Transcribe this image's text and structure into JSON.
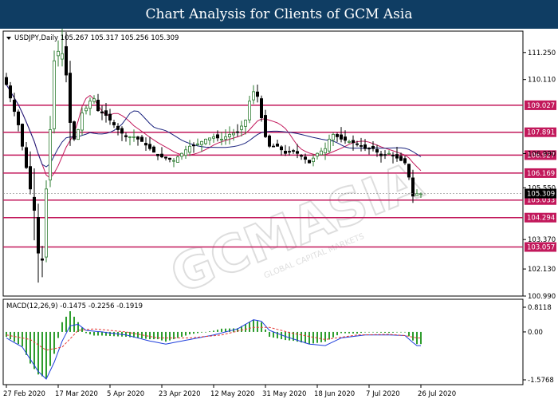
{
  "header": {
    "title": "Chart Analysis for Clients of GCM Asia"
  },
  "price_panel": {
    "label": "USDJPY,Daily  105.267 105.317 105.256 105.309",
    "current_price": "105.309"
  },
  "macd_panel": {
    "label": "MACD(12,26,9) -0.1475 -0.2256 -0.1919"
  },
  "watermark": {
    "text": "GCMASIA",
    "sub": "GLOBAL CAPITAL MARKETS"
  },
  "colors": {
    "up": "#2e7d32",
    "down": "#000000",
    "ma_fast": "#c2185b",
    "ma_slow": "#1a237e",
    "level": "#c2185b",
    "level_label_bg": "#c2185b",
    "price_label_bg": "#000000",
    "macd_hist": "#2e9d2e",
    "macd_line": "#1f3fdc",
    "macd_signal": "#e53935"
  },
  "chart_data": {
    "type": "candlestick",
    "symbol": "USDJPY",
    "timeframe": "Daily",
    "ylim": [
      100.99,
      112.15
    ],
    "y_ticks": [
      "111.250",
      "110.110",
      "109.027",
      "107.891",
      "106.990",
      "106.927",
      "106.169",
      "105.550",
      "105.309",
      "105.033",
      "104.294",
      "103.370",
      "103.057",
      "102.130",
      "100.990"
    ],
    "levels": [
      "109.027",
      "107.891",
      "106.927",
      "106.169",
      "105.033",
      "104.294",
      "103.057"
    ],
    "x_ticks": [
      "27 Feb 2020",
      "17 Mar 2020",
      "5 Apr 2020",
      "23 Apr 2020",
      "12 May 2020",
      "31 May 2020",
      "18 Jun 2020",
      "7 Jul 2020",
      "26 Jul 2020"
    ],
    "x_tick_index": [
      0,
      13,
      26,
      39,
      52,
      65,
      78,
      91,
      104
    ],
    "close_anchors": [
      [
        0,
        109.9
      ],
      [
        3,
        108.2
      ],
      [
        5,
        106.4
      ],
      [
        7,
        104.6
      ],
      [
        8,
        102.8
      ],
      [
        9,
        102.5
      ],
      [
        10,
        105.5
      ],
      [
        11,
        108.0
      ],
      [
        12,
        110.9
      ],
      [
        13,
        111.3
      ],
      [
        14,
        111.2
      ],
      [
        15,
        110.3
      ],
      [
        16,
        108.3
      ],
      [
        17,
        107.6
      ],
      [
        18,
        108.0
      ],
      [
        19,
        108.7
      ],
      [
        20,
        108.9
      ],
      [
        21,
        109.2
      ],
      [
        22,
        109.3
      ],
      [
        23,
        108.8
      ],
      [
        24,
        108.7
      ],
      [
        25,
        108.6
      ],
      [
        26,
        108.4
      ],
      [
        28,
        108.0
      ],
      [
        30,
        107.7
      ],
      [
        32,
        107.7
      ],
      [
        34,
        107.5
      ],
      [
        36,
        107.2
      ],
      [
        38,
        106.9
      ],
      [
        40,
        106.8
      ],
      [
        42,
        106.7
      ],
      [
        44,
        107.0
      ],
      [
        46,
        107.3
      ],
      [
        48,
        107.4
      ],
      [
        50,
        107.6
      ],
      [
        52,
        107.7
      ],
      [
        54,
        107.6
      ],
      [
        56,
        107.8
      ],
      [
        58,
        107.9
      ],
      [
        60,
        108.4
      ],
      [
        61,
        109.2
      ],
      [
        62,
        109.6
      ],
      [
        63,
        109.4
      ],
      [
        64,
        108.5
      ],
      [
        65,
        107.7
      ],
      [
        66,
        107.3
      ],
      [
        68,
        107.3
      ],
      [
        70,
        107.0
      ],
      [
        72,
        107.1
      ],
      [
        74,
        106.9
      ],
      [
        76,
        106.6
      ],
      [
        78,
        107.0
      ],
      [
        80,
        107.2
      ],
      [
        81,
        107.6
      ],
      [
        82,
        107.8
      ],
      [
        84,
        107.6
      ],
      [
        86,
        107.5
      ],
      [
        88,
        107.4
      ],
      [
        90,
        107.2
      ],
      [
        92,
        107.2
      ],
      [
        94,
        106.9
      ],
      [
        96,
        107.0
      ],
      [
        98,
        106.8
      ],
      [
        100,
        106.6
      ],
      [
        101,
        106.0
      ],
      [
        102,
        105.2
      ],
      [
        103,
        105.3
      ]
    ],
    "macd": {
      "label": "MACD(12,26,9)",
      "values": [
        -0.1475,
        -0.2256,
        -0.1919
      ],
      "ylim": [
        -1.5768,
        0.8118
      ],
      "y_ticks": [
        "0.8118",
        "0.00",
        "-1.5768"
      ],
      "line_anchors": [
        [
          0,
          -0.2
        ],
        [
          4,
          -0.5
        ],
        [
          8,
          -1.3
        ],
        [
          10,
          -1.55
        ],
        [
          12,
          -1.0
        ],
        [
          14,
          -0.3
        ],
        [
          16,
          0.2
        ],
        [
          18,
          0.25
        ],
        [
          20,
          0.05
        ],
        [
          24,
          0.0
        ],
        [
          30,
          -0.1
        ],
        [
          36,
          -0.3
        ],
        [
          40,
          -0.4
        ],
        [
          46,
          -0.25
        ],
        [
          52,
          -0.1
        ],
        [
          58,
          0.1
        ],
        [
          62,
          0.4
        ],
        [
          64,
          0.35
        ],
        [
          66,
          0.05
        ],
        [
          70,
          -0.15
        ],
        [
          76,
          -0.4
        ],
        [
          80,
          -0.45
        ],
        [
          84,
          -0.2
        ],
        [
          90,
          -0.1
        ],
        [
          96,
          -0.1
        ],
        [
          100,
          -0.12
        ],
        [
          102,
          -0.35
        ],
        [
          103,
          -0.45
        ]
      ],
      "signal_anchors": [
        [
          0,
          -0.1
        ],
        [
          6,
          -0.25
        ],
        [
          10,
          -0.6
        ],
        [
          14,
          -0.5
        ],
        [
          18,
          0.05
        ],
        [
          22,
          0.1
        ],
        [
          30,
          0.0
        ],
        [
          38,
          -0.2
        ],
        [
          46,
          -0.2
        ],
        [
          54,
          -0.1
        ],
        [
          62,
          0.15
        ],
        [
          66,
          0.15
        ],
        [
          72,
          -0.05
        ],
        [
          80,
          -0.25
        ],
        [
          88,
          -0.1
        ],
        [
          96,
          -0.08
        ],
        [
          100,
          -0.12
        ],
        [
          103,
          -0.2
        ]
      ]
    }
  }
}
